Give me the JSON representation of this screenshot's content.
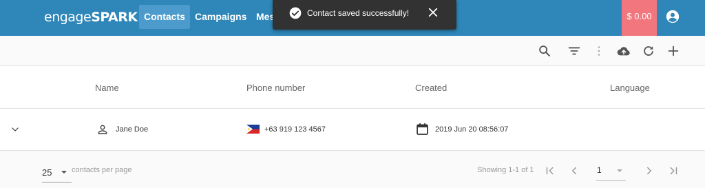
{
  "topbar": {
    "logo_prefix": "engage",
    "logo_suffix": "SPARK",
    "nav": [
      {
        "label": "Contacts",
        "active": true
      },
      {
        "label": "Campaigns",
        "active": false
      },
      {
        "label": "Mes",
        "active": false
      }
    ],
    "balance": "$ 0.00",
    "account_icon": "account-circle-icon"
  },
  "toast": {
    "message": "Contact saved successfully!",
    "icon": "check-circle-icon",
    "close_icon": "close-icon"
  },
  "toolbar": {
    "icons": [
      "search-icon",
      "filter-icon",
      "more-vertical-icon",
      "cloud-upload-icon",
      "refresh-icon",
      "add-icon"
    ]
  },
  "table": {
    "columns": [
      "Name",
      "Phone number",
      "Created",
      "Language"
    ],
    "rows": [
      {
        "name": "Jane  Doe",
        "phone": "+63 919 123 4567",
        "country_flag": "philippines-flag",
        "created": "2019 Jun 20 08:56:07",
        "language": ""
      }
    ]
  },
  "pagination": {
    "per_page_value": "25",
    "per_page_label": "contacts per page",
    "showing": "Showing 1-1 of 1",
    "page": "1"
  },
  "colors": {
    "topbar": "#2e86b9",
    "nav_active": "#4c9bcc",
    "balance": "#f2767d",
    "toast": "#323232"
  }
}
